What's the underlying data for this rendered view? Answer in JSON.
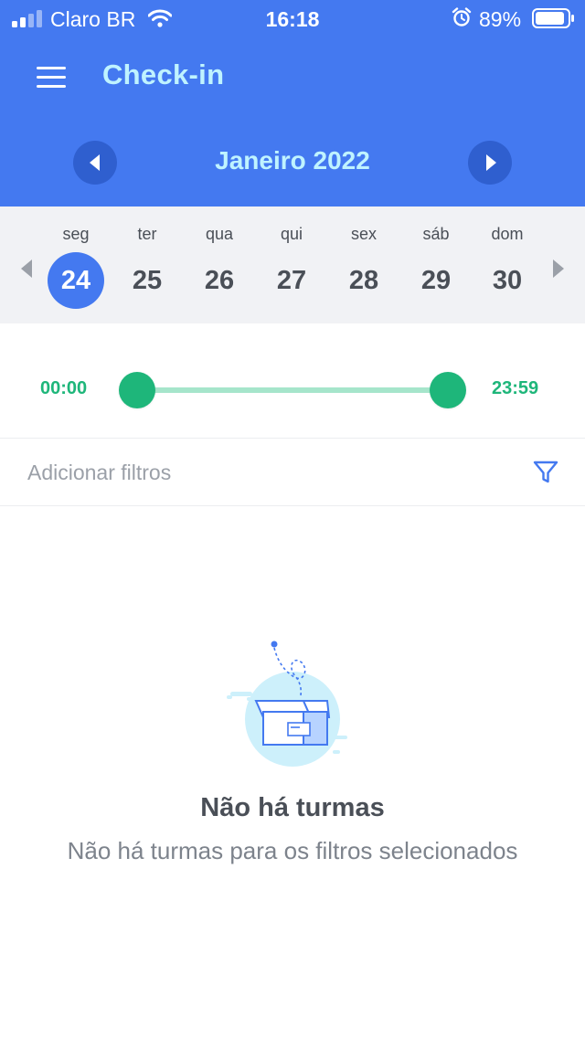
{
  "status_bar": {
    "carrier": "Claro BR",
    "time": "16:18",
    "battery": "89%"
  },
  "header": {
    "title": "Check-in",
    "month": "Janeiro 2022"
  },
  "week": {
    "days": [
      {
        "name": "seg",
        "num": "24",
        "selected": true
      },
      {
        "name": "ter",
        "num": "25",
        "selected": false
      },
      {
        "name": "qua",
        "num": "26",
        "selected": false
      },
      {
        "name": "qui",
        "num": "27",
        "selected": false
      },
      {
        "name": "sex",
        "num": "28",
        "selected": false
      },
      {
        "name": "sáb",
        "num": "29",
        "selected": false
      },
      {
        "name": "dom",
        "num": "30",
        "selected": false
      }
    ]
  },
  "time_range": {
    "start": "00:00",
    "end": "23:59"
  },
  "filters": {
    "label": "Adicionar filtros"
  },
  "empty_state": {
    "title": "Não há turmas",
    "subtitle": "Não há turmas para os filtros selecionados"
  },
  "icons": {
    "menu": "hamburger-icon",
    "month_prev": "chevron-left-icon",
    "month_next": "chevron-right-icon",
    "week_prev": "triangle-left-icon",
    "week_next": "triangle-right-icon",
    "filter": "funnel-icon",
    "empty": "empty-box-icon"
  },
  "colors": {
    "primary": "#4479F0",
    "title_text": "#BFF3FF",
    "accent_green": "#1EB67A",
    "track_green": "#A6E5CB",
    "week_bg": "#F1F2F5"
  }
}
